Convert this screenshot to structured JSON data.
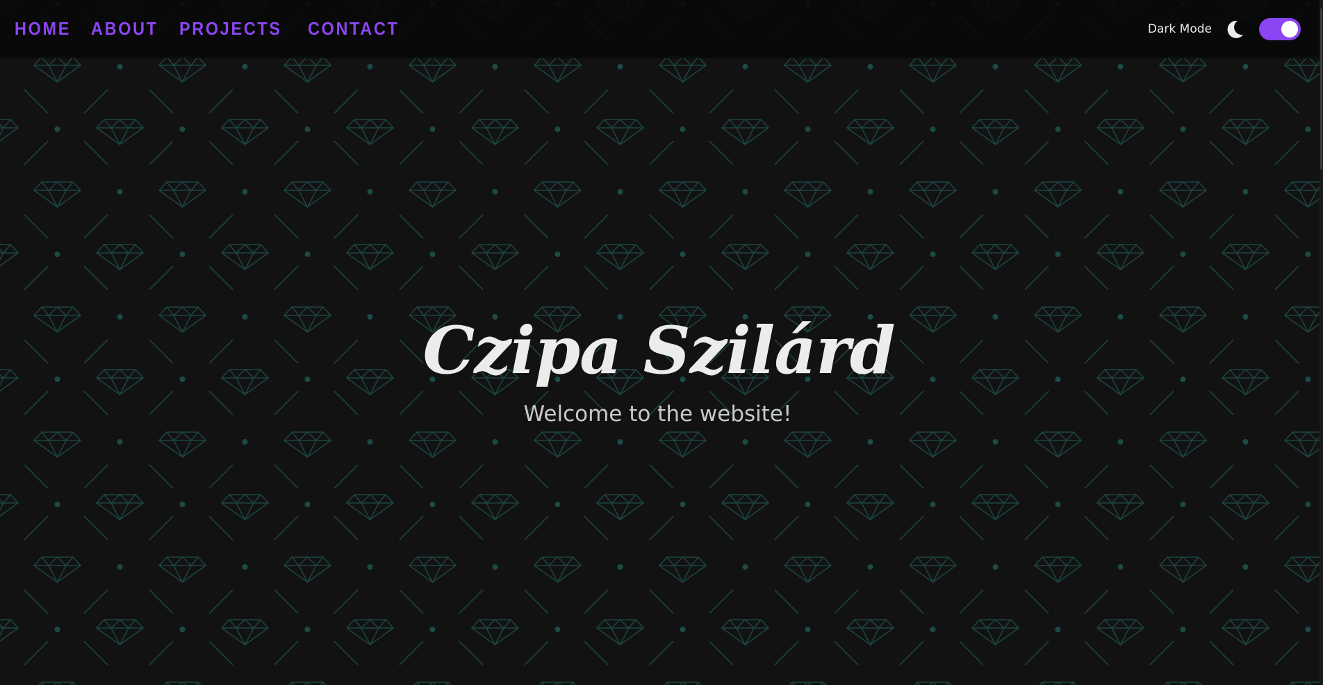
{
  "nav": {
    "items": [
      {
        "label": "HOME"
      },
      {
        "label": "ABOUT"
      },
      {
        "label": "PROJECTS"
      },
      {
        "label": "CONTACT"
      }
    ]
  },
  "theme": {
    "label": "Dark Mode",
    "icon": "moon-icon",
    "toggle_on": true,
    "accent": "#8c45f2",
    "background": "#121212",
    "pattern_color": "#163a38"
  },
  "hero": {
    "title": "Czipa Szilárd",
    "subtitle": "Welcome to the website!"
  }
}
